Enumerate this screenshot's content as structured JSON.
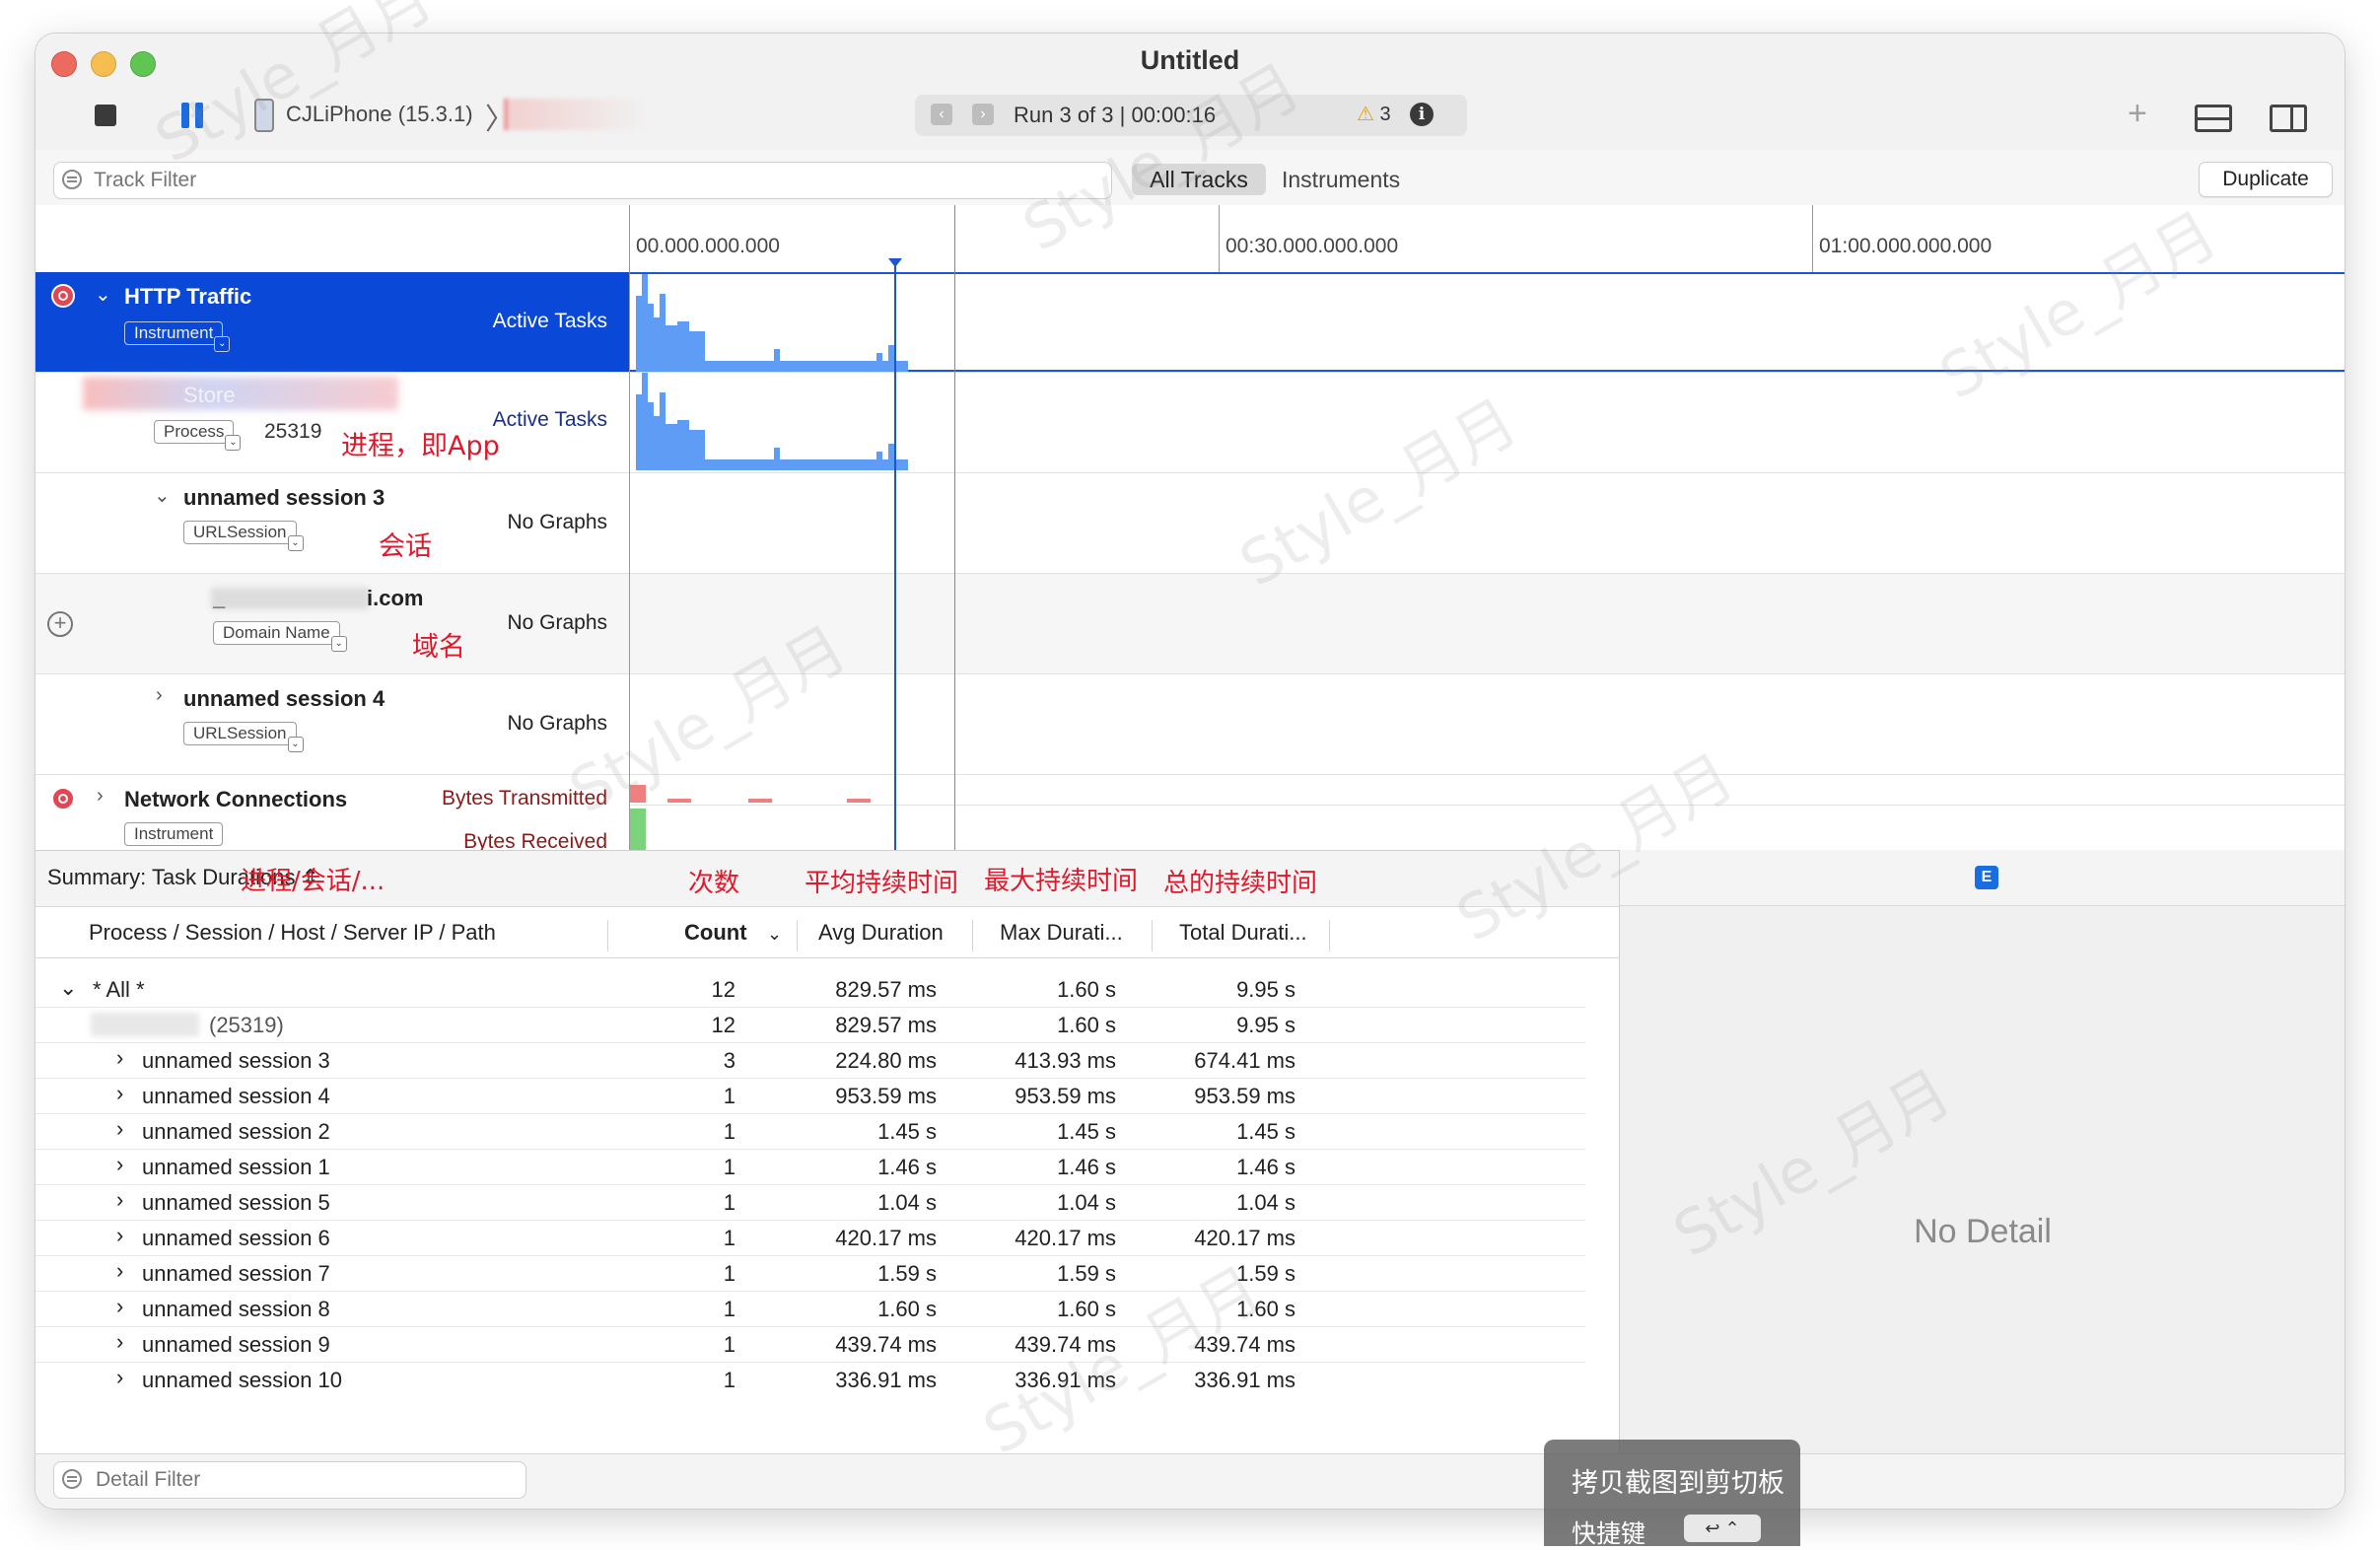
{
  "window": {
    "title": "Untitled"
  },
  "toolbar": {
    "device_name": "CJLiPhone (15.3.1)",
    "run_text": "Run 3 of 3  |  00:00:16",
    "warning_count": "3"
  },
  "filterbar": {
    "track_filter_placeholder": "Track Filter",
    "tab_all_tracks": "All Tracks",
    "tab_instruments": "Instruments",
    "duplicate_label": "Duplicate"
  },
  "ruler": {
    "ticks": [
      "00.000.000.000",
      "00:30.000.000.000",
      "01:00.000.000.000"
    ]
  },
  "tracks": [
    {
      "name": "HTTP Traffic",
      "tag": "Instrument",
      "graph": "Active Tasks",
      "selected": true
    },
    {
      "name": "Store",
      "tag": "Process",
      "pid": "25319",
      "graph": "Active Tasks",
      "annotation": "进程，即App"
    },
    {
      "name": "unnamed session 3",
      "tag": "URLSession",
      "graph": "No Graphs",
      "annotation": "会话"
    },
    {
      "name": "i.com",
      "name_prefix": "_",
      "tag": "Domain Name",
      "graph": "No Graphs",
      "annotation": "域名"
    },
    {
      "name": "unnamed session 4",
      "tag": "URLSession",
      "graph": "No Graphs"
    },
    {
      "name": "Network Connections",
      "tag": "Instrument",
      "graph": "Bytes Transmitted",
      "graph2": "Bytes Received"
    }
  ],
  "summary": {
    "title": "Summary: Task Durations",
    "annotation_path": "进程/会话/...",
    "annotation_count": "次数",
    "annotation_avg": "平均持续时间",
    "annotation_max": "最大持续时间",
    "annotation_total": "总的持续时间",
    "columns": {
      "path": "Process / Session / Host / Server IP / Path",
      "count": "Count",
      "avg": "Avg Duration",
      "max": "Max Durati...",
      "total": "Total Durati..."
    },
    "rows": [
      {
        "name": "* All *",
        "count": "12",
        "avg": "829.57 ms",
        "max": "1.60 s",
        "total": "9.95 s"
      },
      {
        "name": "(25319)",
        "count": "12",
        "avg": "829.57 ms",
        "max": "1.60 s",
        "total": "9.95 s"
      },
      {
        "name": "unnamed session 3",
        "count": "3",
        "avg": "224.80 ms",
        "max": "413.93 ms",
        "total": "674.41 ms"
      },
      {
        "name": "unnamed session 4",
        "count": "1",
        "avg": "953.59 ms",
        "max": "953.59 ms",
        "total": "953.59 ms"
      },
      {
        "name": "unnamed session 2",
        "count": "1",
        "avg": "1.45 s",
        "max": "1.45 s",
        "total": "1.45 s"
      },
      {
        "name": "unnamed session 1",
        "count": "1",
        "avg": "1.46 s",
        "max": "1.46 s",
        "total": "1.46 s"
      },
      {
        "name": "unnamed session 5",
        "count": "1",
        "avg": "1.04 s",
        "max": "1.04 s",
        "total": "1.04 s"
      },
      {
        "name": "unnamed session 6",
        "count": "1",
        "avg": "420.17 ms",
        "max": "420.17 ms",
        "total": "420.17 ms"
      },
      {
        "name": "unnamed session 7",
        "count": "1",
        "avg": "1.59 s",
        "max": "1.59 s",
        "total": "1.59 s"
      },
      {
        "name": "unnamed session 8",
        "count": "1",
        "avg": "1.60 s",
        "max": "1.60 s",
        "total": "1.60 s"
      },
      {
        "name": "unnamed session 9",
        "count": "1",
        "avg": "439.74 ms",
        "max": "439.74 ms",
        "total": "439.74 ms"
      },
      {
        "name": "unnamed session 10",
        "count": "1",
        "avg": "336.91 ms",
        "max": "336.91 ms",
        "total": "336.91 ms"
      }
    ]
  },
  "detail": {
    "badge": "E",
    "no_detail": "No Detail",
    "filter_placeholder": "Detail Filter"
  },
  "toast": {
    "line1": "拷贝截图到剪切板",
    "line2": "快捷键",
    "key": "↩ ⌃"
  },
  "watermark": "Style_月月",
  "colors": {
    "selection": "#0a49d7",
    "graph_blue": "#5e9cf5",
    "annotation_red": "#e0182b",
    "bytes_tx": "#f08080",
    "bytes_rx": "#7bd47b"
  }
}
